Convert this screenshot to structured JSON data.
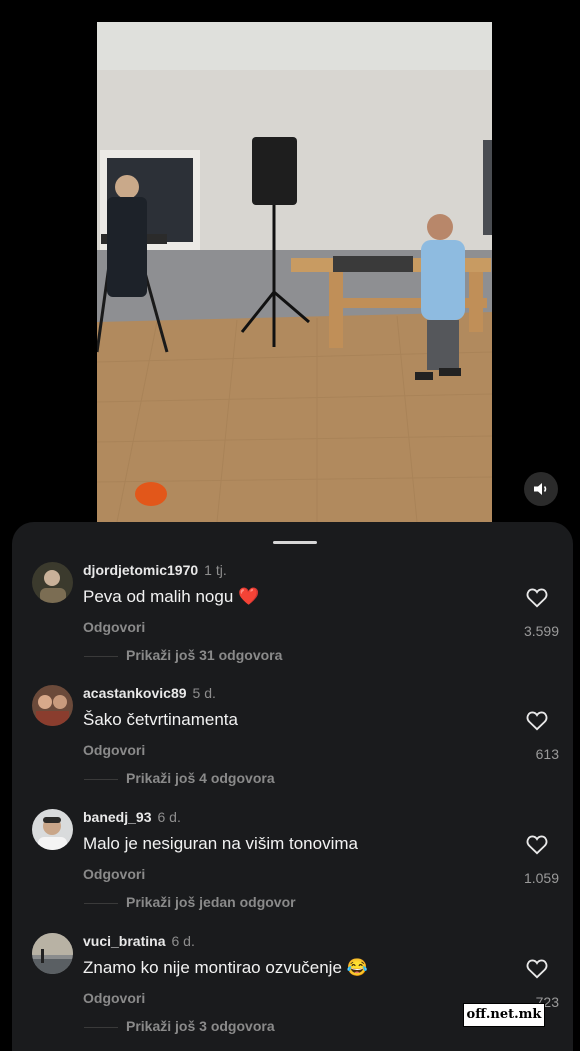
{
  "video": {
    "mute_icon": "speaker-icon"
  },
  "comments_panel": {
    "comments": [
      {
        "username": "djordjetomic1970",
        "time": "1 tj.",
        "text": "Peva od malih nogu",
        "emoji": "❤️",
        "reply_label": "Odgovori",
        "more_replies": "Prikaži još 31 odgovora",
        "likes": "3.599"
      },
      {
        "username": "acastankovic89",
        "time": "5 d.",
        "text": "Šako četvrtinamenta",
        "emoji": "",
        "reply_label": "Odgovori",
        "more_replies": "Prikaži još 4 odgovora",
        "likes": "613"
      },
      {
        "username": "banedj_93",
        "time": "6 d.",
        "text": "Malo je nesiguran na višim tonovima",
        "emoji": "",
        "reply_label": "Odgovori",
        "more_replies": "Prikaži još jedan odgovor",
        "likes": "1.059"
      },
      {
        "username": "vuci_bratina",
        "time": "6 d.",
        "text": "Znamo ko nije montirao ozvučenje",
        "emoji": "😂",
        "reply_label": "Odgovori",
        "more_replies": "Prikaži još 3 odgovora",
        "likes": "723"
      }
    ]
  },
  "watermark": "off.net.mk"
}
